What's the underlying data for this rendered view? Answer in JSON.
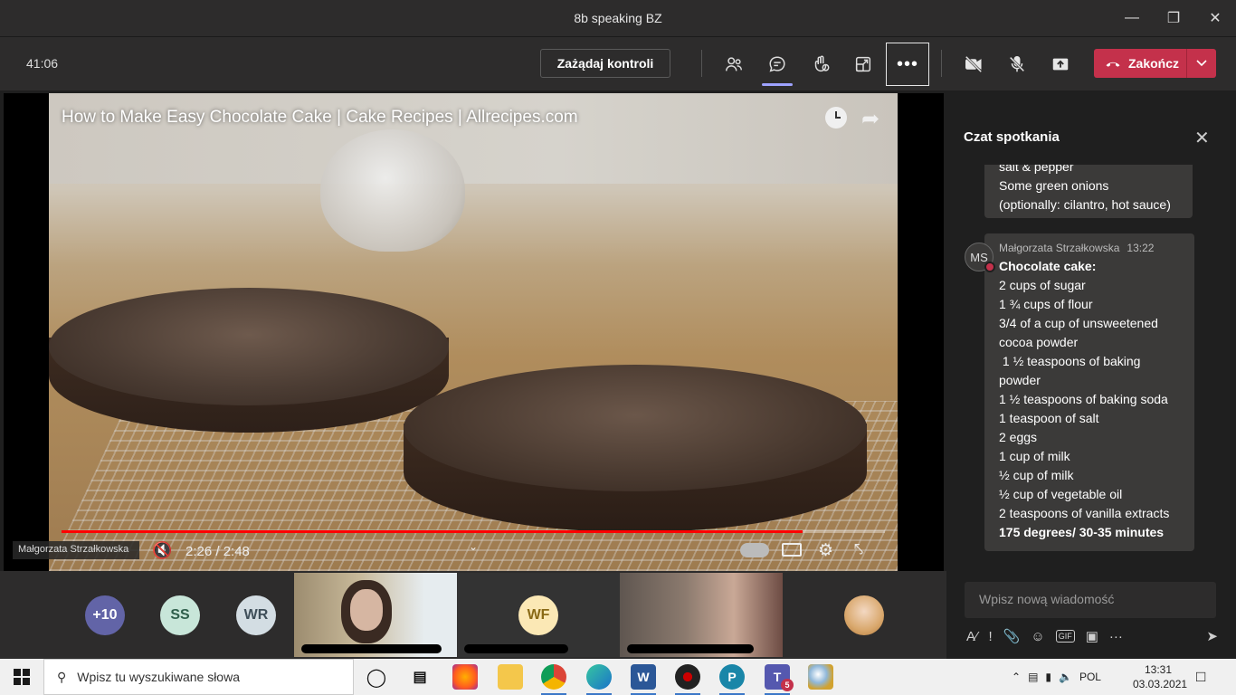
{
  "window": {
    "title": "8b speaking BZ",
    "controls": [
      "minimize-icon",
      "maximize-icon",
      "close-icon"
    ]
  },
  "toolbar": {
    "timer": "41:06",
    "request_control_label": "Zażądaj kontroli",
    "icons": [
      "participants-icon",
      "chat-icon",
      "reactions-icon",
      "share-tray-icon",
      "more-icon",
      "camera-off-icon",
      "mic-off-icon",
      "share-screen-icon"
    ],
    "end_label": "Zakończ",
    "end_color": "#c4314b",
    "accent": "#9ea2ff"
  },
  "video": {
    "title": "How to Make Easy Chocolate Cake | Cake Recipes | Allrecipes.com",
    "progress": 0.9,
    "time": "2:26 / 2:48",
    "presenter_tag": "Małgorzata Strzałkowska"
  },
  "chat": {
    "title": "Czat spotkania",
    "prev_message_lines": [
      "salt & pepper",
      "Some green onions",
      "(optionally: cilantro, hot sauce)"
    ],
    "message": {
      "avatar": "MS",
      "author": "Małgorzata Strzałkowska",
      "time": "13:22",
      "heading": "Chocolate cake:",
      "lines": [
        "2 cups of sugar",
        "1 ¾ cups of flour",
        "3/4 of a cup of unsweetened cocoa powder",
        " 1 ½ teaspoons of baking powder",
        "1 ½ teaspoons of baking soda",
        "1 teaspoon of salt",
        "2 eggs",
        "1 cup of milk",
        "½ cup of milk",
        "½ cup of vegetable oil",
        "2 teaspoons of vanilla extracts"
      ],
      "footer": "175 degrees/ 30-35 minutes"
    },
    "compose_placeholder": "Wpisz nową wiadomość"
  },
  "gallery": {
    "overflow_count": "+10",
    "avatars": [
      {
        "initials": "SS",
        "color": "#c8e6d9",
        "text_color": "#2f5f4c"
      },
      {
        "initials": "WR",
        "color": "#d3dde3",
        "text_color": "#3f4f5a"
      },
      {
        "initials": "WF",
        "color": "#fbe8b5",
        "text_color": "#8a6a16"
      }
    ],
    "overflow_color": "#6264a7"
  },
  "taskbar": {
    "search_placeholder": "Wpisz tu wyszukiwane słowa",
    "teams_badge": "5",
    "language": "POL",
    "time": "13:31",
    "date": "03.03.2021"
  }
}
